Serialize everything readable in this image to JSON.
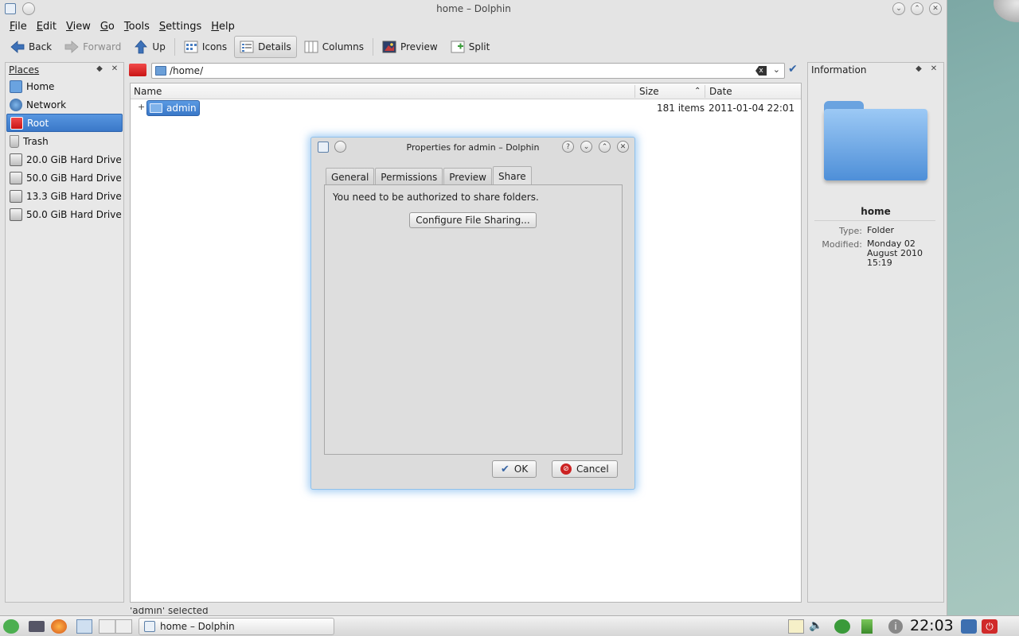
{
  "window": {
    "title": "home – Dolphin"
  },
  "menubar": {
    "items": [
      "File",
      "Edit",
      "View",
      "Go",
      "Tools",
      "Settings",
      "Help"
    ]
  },
  "toolbar": {
    "back": "Back",
    "forward": "Forward",
    "up": "Up",
    "icons": "Icons",
    "details": "Details",
    "columns": "Columns",
    "preview": "Preview",
    "split": "Split"
  },
  "places": {
    "title": "Places",
    "items": [
      {
        "label": "Home",
        "icon": "home-folder-icon"
      },
      {
        "label": "Network",
        "icon": "network-globe-icon"
      },
      {
        "label": "Root",
        "icon": "red-folder-icon",
        "selected": true
      },
      {
        "label": "Trash",
        "icon": "trash-icon"
      },
      {
        "label": "20.0 GiB Hard Drive",
        "icon": "hard-drive-icon"
      },
      {
        "label": "50.0 GiB Hard Drive",
        "icon": "hard-drive-icon"
      },
      {
        "label": "13.3 GiB Hard Drive",
        "icon": "hard-drive-icon"
      },
      {
        "label": "50.0 GiB Hard Drive",
        "icon": "hard-drive-icon"
      }
    ]
  },
  "location": {
    "path": "/home/"
  },
  "fileview": {
    "columns": {
      "name": "Name",
      "size": "Size",
      "date": "Date"
    },
    "rows": [
      {
        "name": "admin",
        "size": "181 items",
        "date": "2011-01-04 22:01"
      }
    ]
  },
  "status": {
    "text": "'admin' selected"
  },
  "info": {
    "title": "Information",
    "name": "home",
    "type_label": "Type:",
    "type_value": "Folder",
    "modified_label": "Modified:",
    "modified_value": "Monday 02 August 2010 15:19"
  },
  "dialog": {
    "title": "Properties for admin – Dolphin",
    "tabs": [
      "General",
      "Permissions",
      "Preview",
      "Share"
    ],
    "active_tab": "Share",
    "message": "You need to be authorized to share folders.",
    "configure_button": "Configure File Sharing...",
    "ok": "OK",
    "cancel": "Cancel"
  },
  "taskbar": {
    "task_label": "home – Dolphin",
    "clock": "22:03"
  },
  "colors": {
    "selection": "#3a78c8",
    "root_red": "#d41a1a",
    "dialog_glow": "#8fc1ea"
  }
}
